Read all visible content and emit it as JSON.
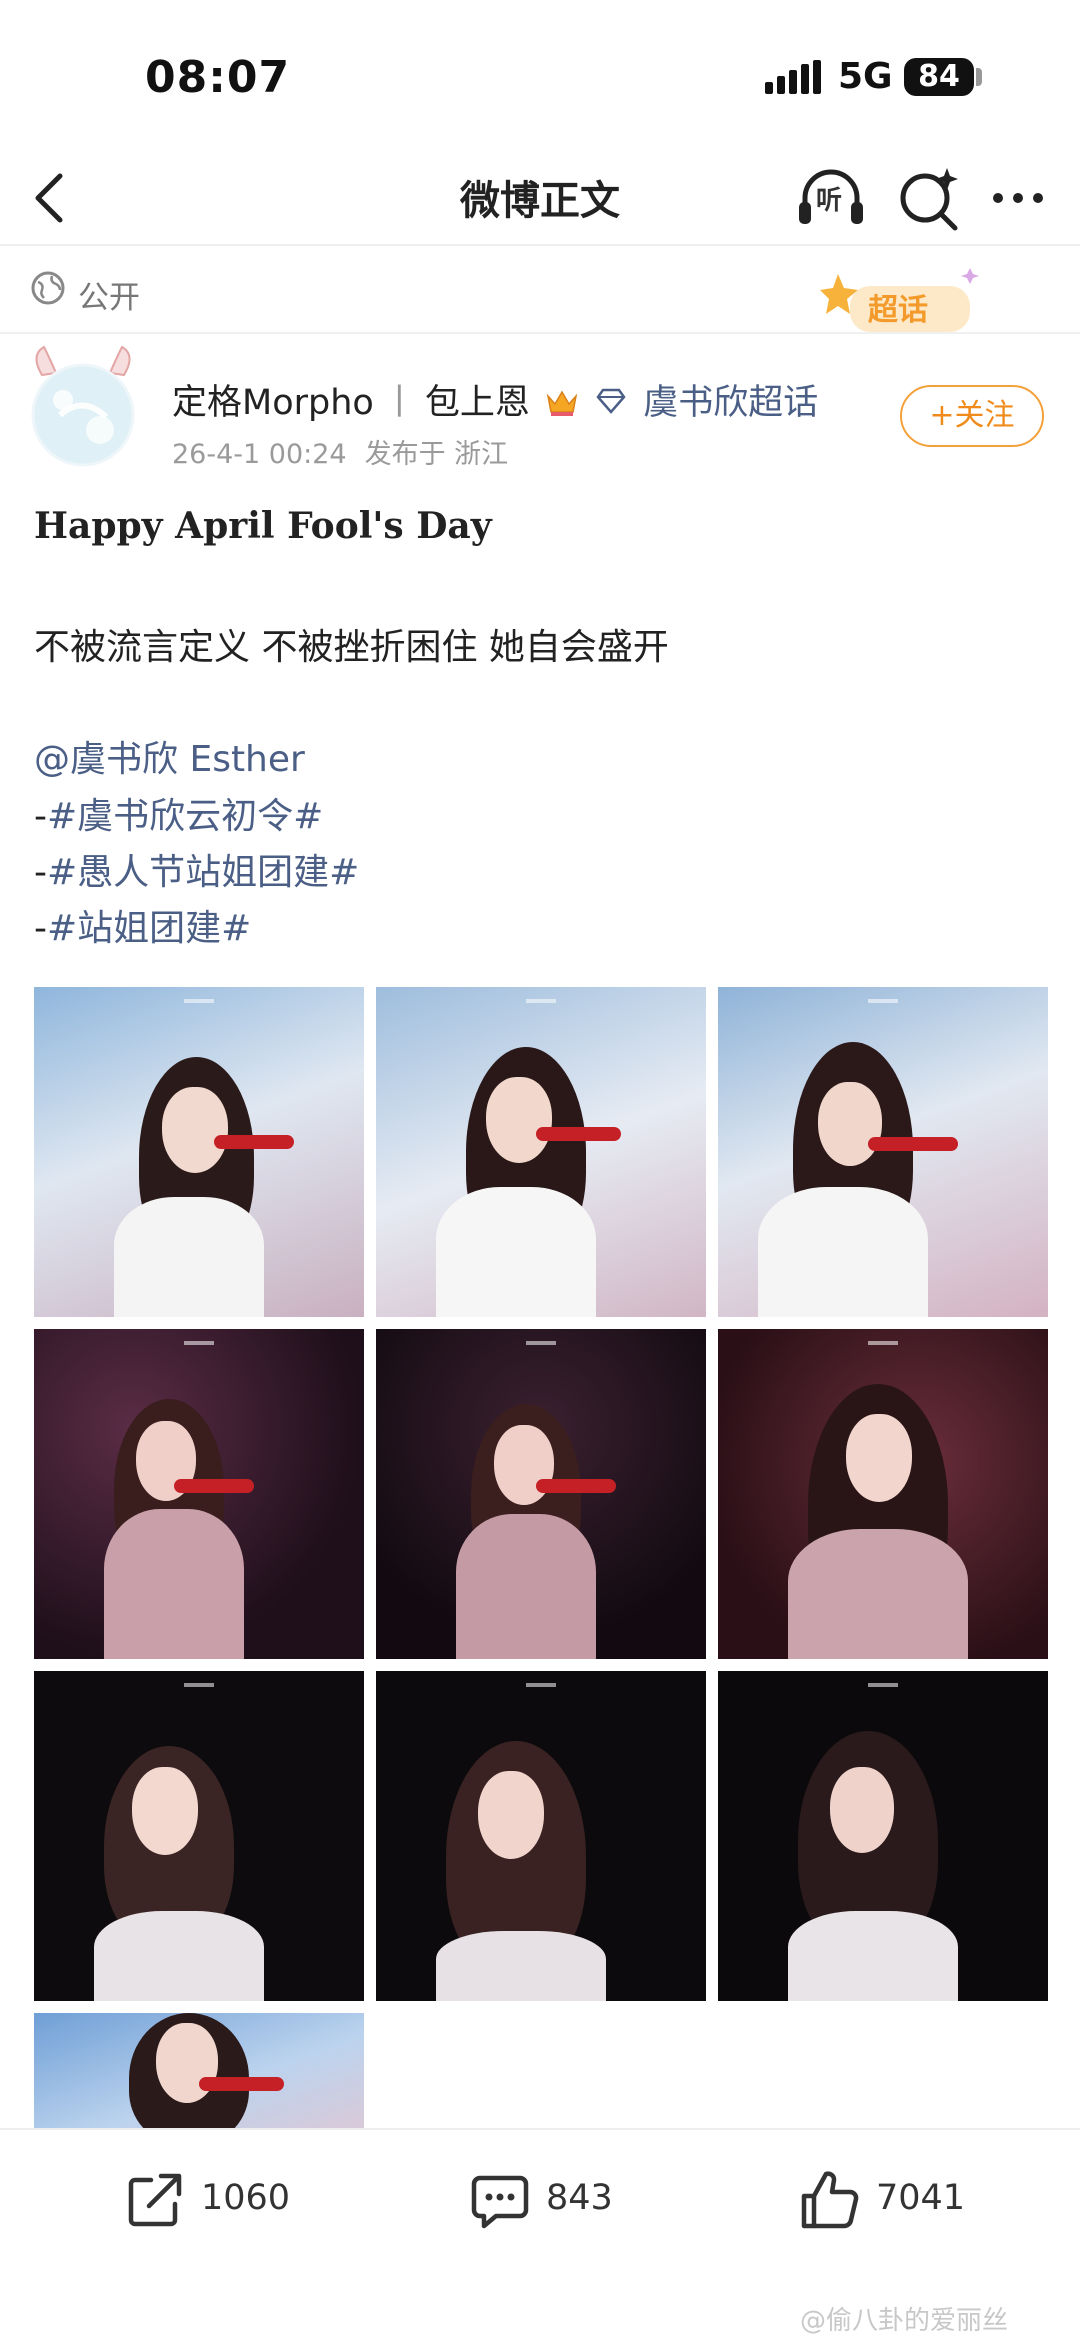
{
  "status_bar": {
    "time": "08:07",
    "network": "5G",
    "battery": "84"
  },
  "nav": {
    "title": "微博正文",
    "listen_label": "听"
  },
  "visibility": {
    "label": "公开",
    "supertopic_badge": "超话"
  },
  "author": {
    "name": "定格Morpho",
    "separator": "丨",
    "alias": "包上恩",
    "topic": "虞书欣超话",
    "date": "26-4-1 00:24",
    "location": "发布于 浙江",
    "follow_label": "+关注"
  },
  "post": {
    "headline": "Happy April Fool's Day",
    "line1": "不被流言定义 不被挫折困住 她自会盛开",
    "mention": "@虞书欣 Esther",
    "tags": [
      "#虞书欣云初令#",
      "#愚人节站姐团建#",
      "#站姐团建#"
    ],
    "tag_prefix": "-"
  },
  "actions": {
    "repost_count": "1060",
    "comment_count": "843",
    "like_count": "7041"
  },
  "watermark": "@偷八卦的爱丽丝",
  "icons": [
    "back-arrow-icon",
    "headphones-icon",
    "search-sparkle-icon",
    "more-dots-icon",
    "globe-icon",
    "crown-icon",
    "diamond-icon",
    "share-icon",
    "comment-icon",
    "like-icon"
  ],
  "colors": {
    "link": "#4b5f86",
    "follow": "#f08b1b"
  }
}
